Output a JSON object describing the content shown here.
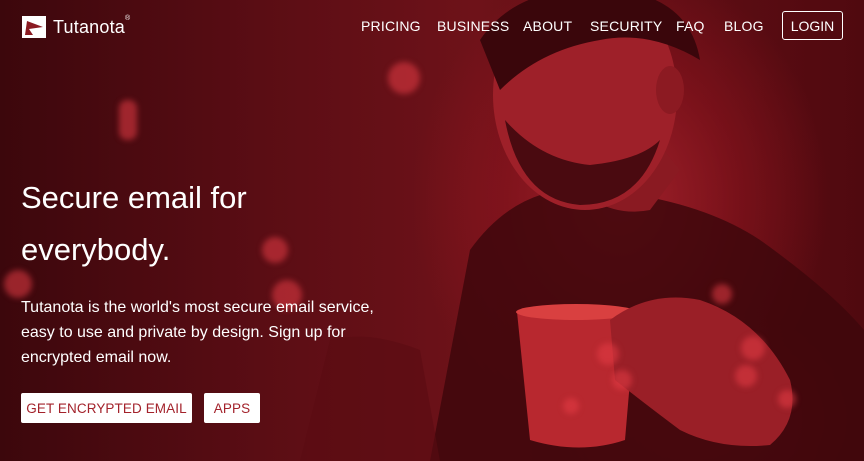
{
  "brand": {
    "name": "Tutanota",
    "name_prefix": "Tuta",
    "name_suffix": "nota",
    "trademark": "®"
  },
  "nav": {
    "items": [
      {
        "label": "PRICING"
      },
      {
        "label": "BUSINESS"
      },
      {
        "label": "ABOUT"
      },
      {
        "label": "SECURITY"
      },
      {
        "label": "FAQ"
      },
      {
        "label": "BLOG"
      }
    ],
    "login_label": "LOGIN"
  },
  "hero": {
    "headline_line1": "Secure email for",
    "headline_line2": "everybody.",
    "description": "Tutanota is the world's most secure email service, easy to use and private by design. Sign up for encrypted email now.",
    "primary_button": "GET ENCRYPTED EMAIL",
    "secondary_button": "APPS"
  },
  "colors": {
    "overlay": "#6e1219",
    "accent_text": "#a3222b",
    "text": "#ffffff"
  }
}
